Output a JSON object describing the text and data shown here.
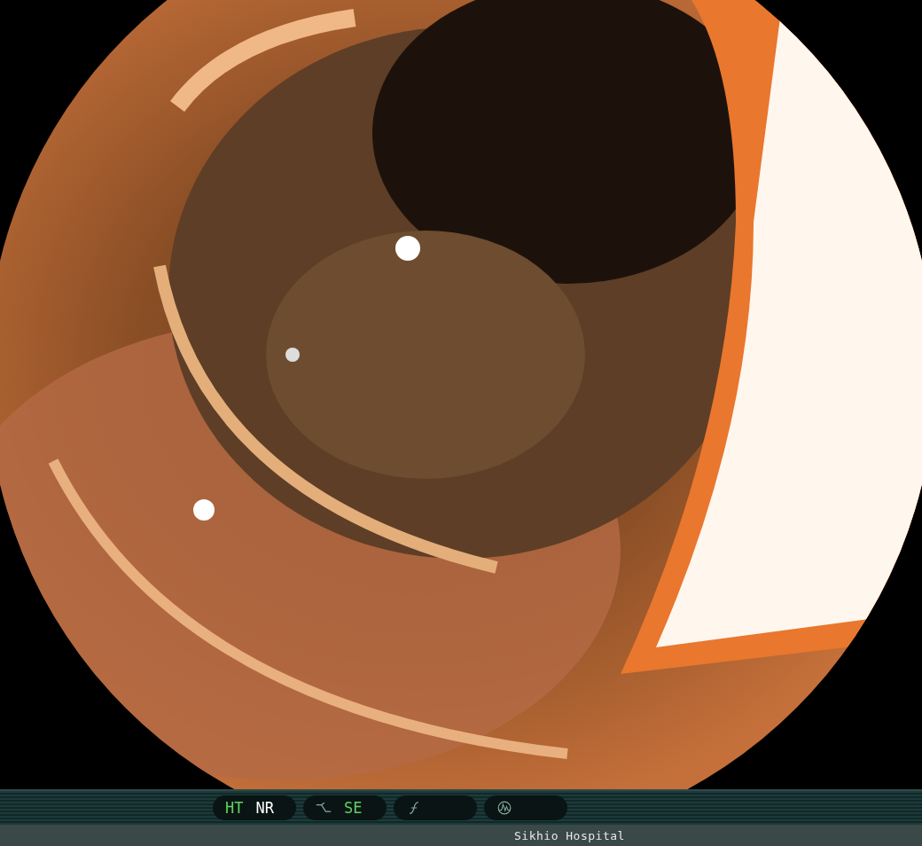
{
  "status_bar": {
    "groups": [
      {
        "items": [
          {
            "kind": "text",
            "label": "HT",
            "active": true
          },
          {
            "kind": "text",
            "label": "NR",
            "active": false
          }
        ]
      },
      {
        "items": [
          {
            "kind": "curve"
          },
          {
            "kind": "text",
            "label": "SE",
            "active": true
          }
        ]
      },
      {
        "items": [
          {
            "kind": "f"
          }
        ]
      },
      {
        "items": [
          {
            "kind": "wave"
          }
        ]
      }
    ]
  },
  "footer": {
    "text": "Sikhio Hospital"
  }
}
